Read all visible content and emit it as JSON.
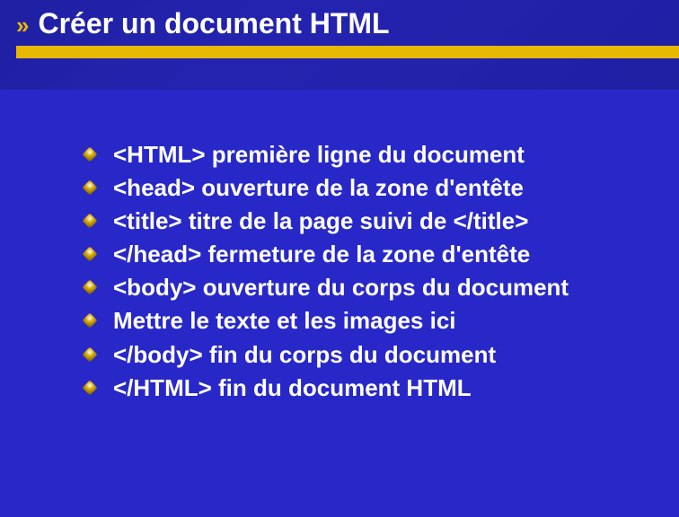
{
  "header": {
    "marker": "»",
    "title": "Créer un document HTML"
  },
  "bullets": [
    "<HTML>  première ligne du document",
    "<head>   ouverture de la zone d'entête",
    "<title>      titre de la page suivi de </title>",
    "</head>  fermeture de la zone d'entête",
    "<body>   ouverture du corps du document",
    "Mettre le texte et les images ici",
    "</body>  fin du corps du document",
    "</HTML>  fin du document HTML"
  ]
}
